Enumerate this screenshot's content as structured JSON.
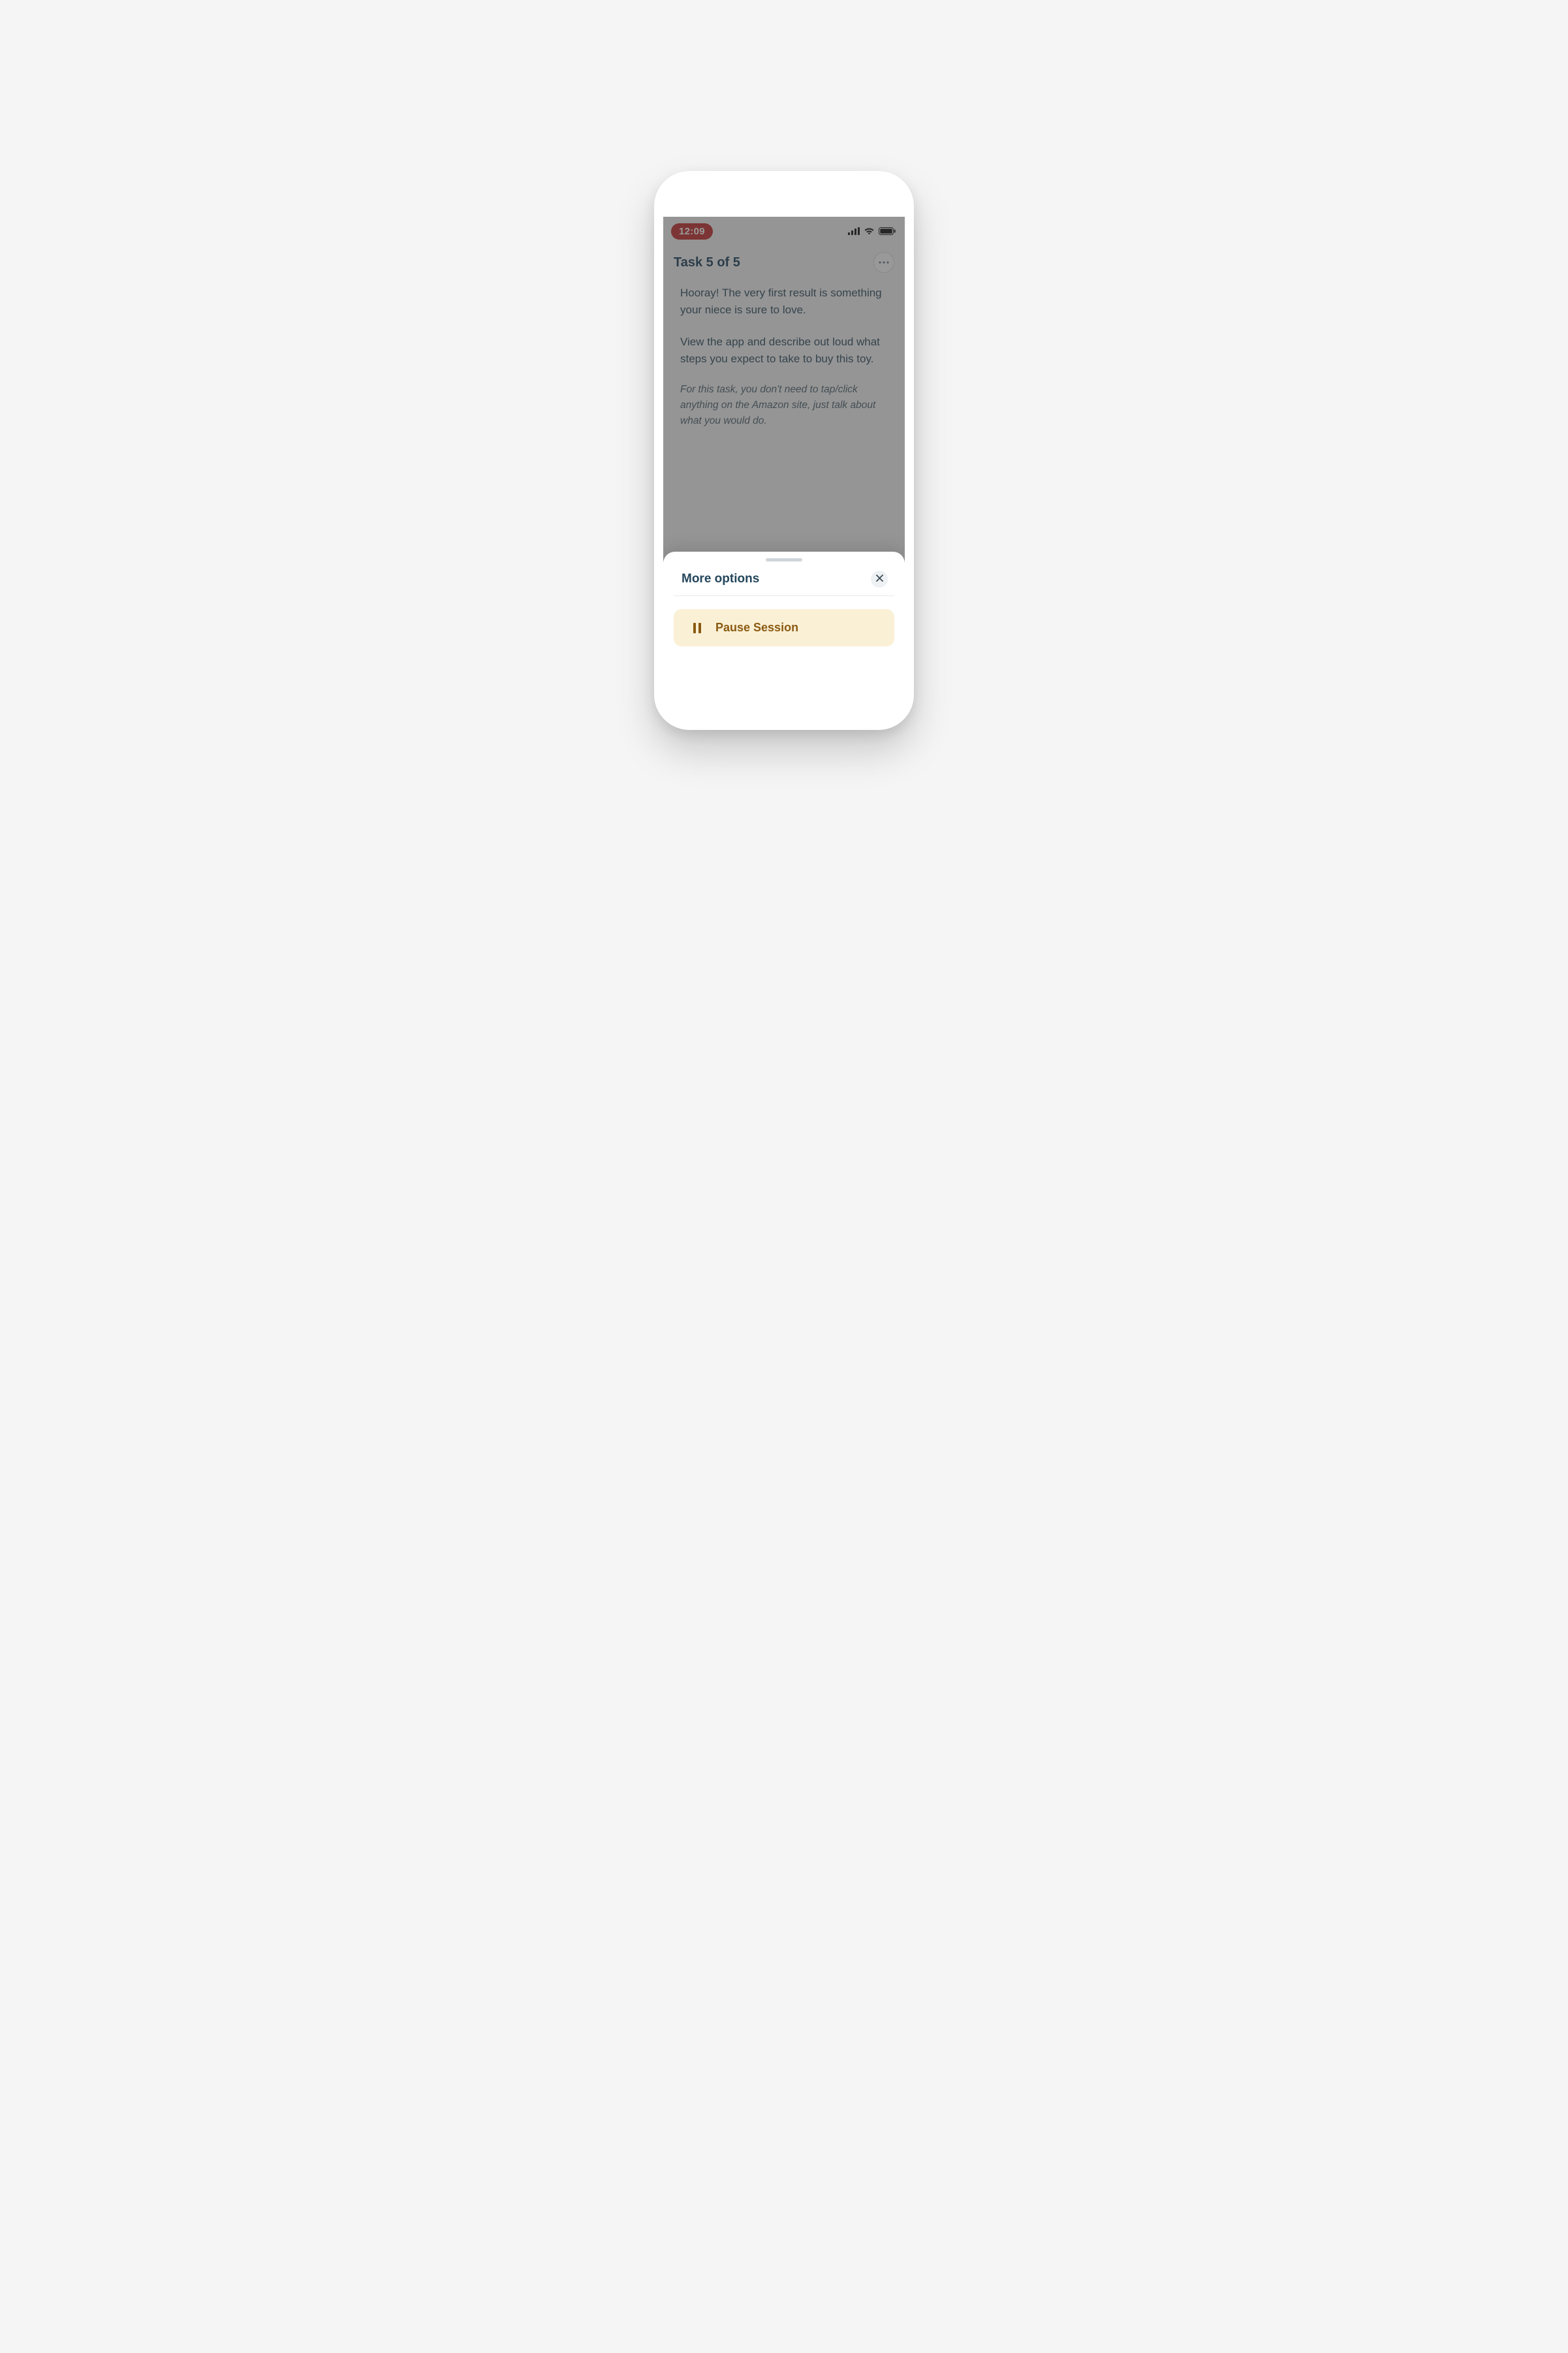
{
  "statusBar": {
    "time": "12:09",
    "icons": {
      "signal": "signal-icon",
      "wifi": "wifi-icon",
      "battery": "battery-icon"
    }
  },
  "task": {
    "title": "Task 5 of 5",
    "para1": "Hooray! The very first result is something your niece is sure to love.",
    "para2": "View the app and describe out loud what steps you expect to take to buy this toy.",
    "note": "For this task, you don't need to tap/click anything on the Amazon site, just talk about what you would do."
  },
  "sheet": {
    "title": "More options",
    "pauseLabel": "Pause Session"
  }
}
